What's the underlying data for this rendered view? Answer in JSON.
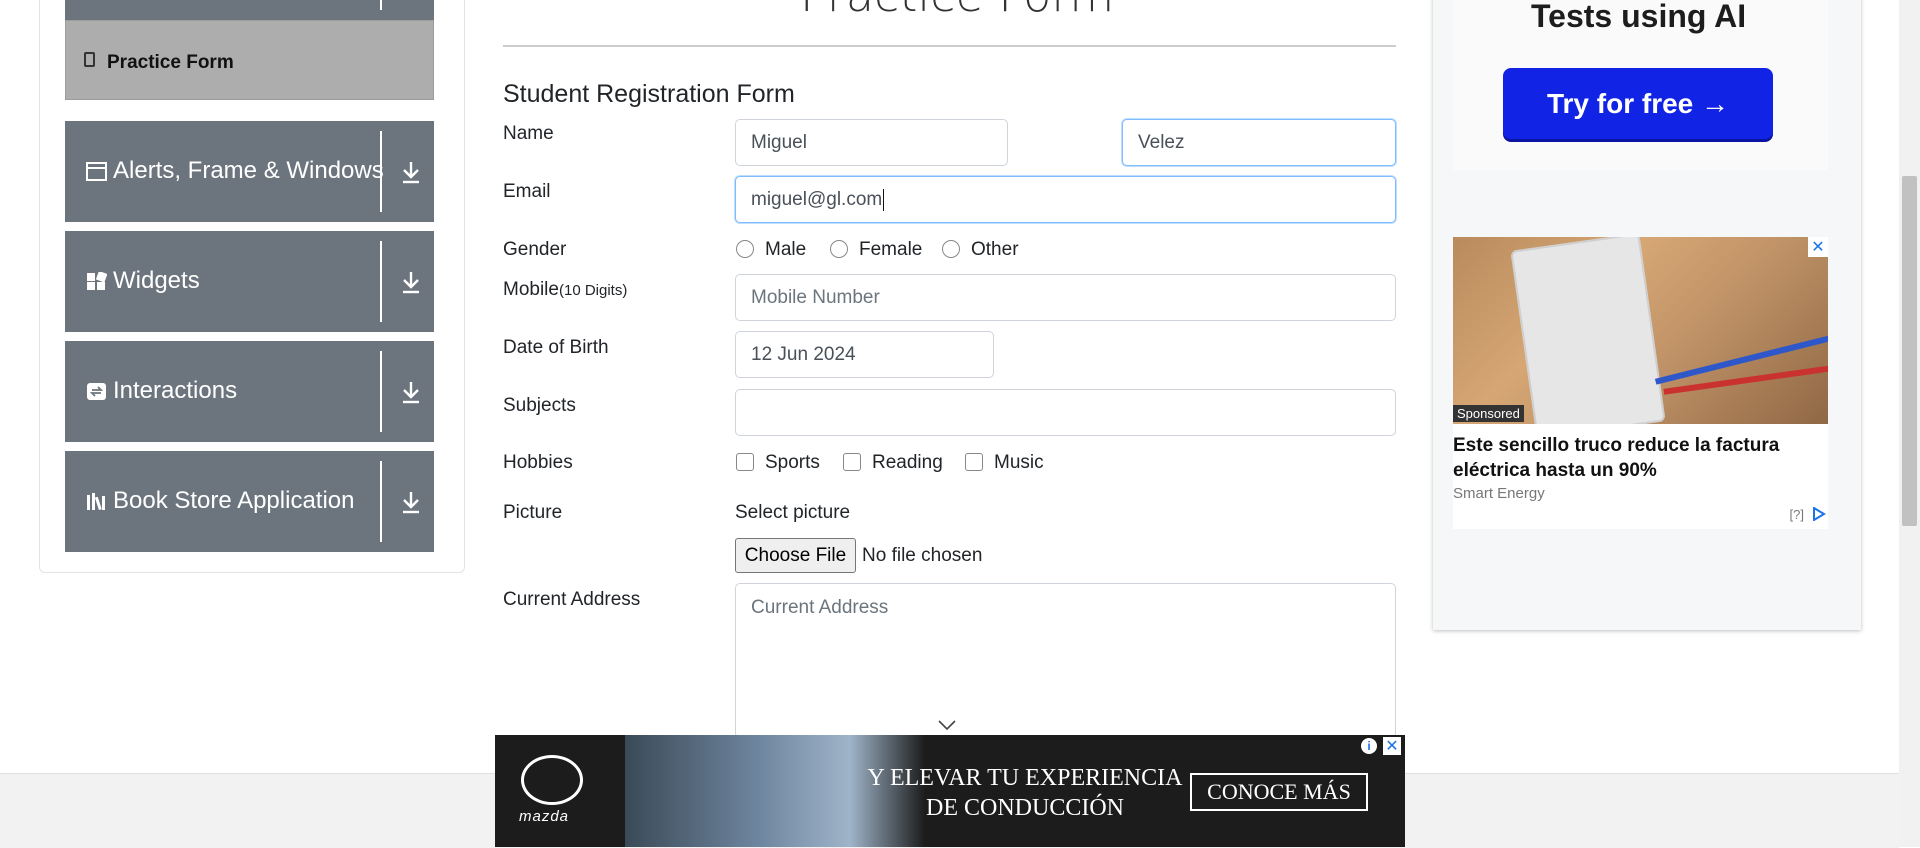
{
  "sidebar": {
    "active_item": "Practice Form",
    "groups": [
      {
        "label": "Alerts, Frame & Windows",
        "icon": "window-icon"
      },
      {
        "label": "Widgets",
        "icon": "widgets-icon"
      },
      {
        "label": "Interactions",
        "icon": "interactions-icon"
      },
      {
        "label": "Book Store Application",
        "icon": "book-store-icon"
      }
    ]
  },
  "header": {
    "title_fragment": "Practice Form"
  },
  "form": {
    "title": "Student Registration Form",
    "name_label": "Name",
    "first_name_value": "Miguel",
    "last_name_value": "Velez",
    "email_label": "Email",
    "email_value": "miguel@gl.com",
    "gender_label": "Gender",
    "gender_options": [
      "Male",
      "Female",
      "Other"
    ],
    "mobile_label": "Mobile",
    "mobile_hint": "(10 Digits)",
    "mobile_placeholder": "Mobile Number",
    "dob_label": "Date of Birth",
    "dob_value": "12 Jun 2024",
    "subjects_label": "Subjects",
    "hobbies_label": "Hobbies",
    "hobbies_options": [
      "Sports",
      "Reading",
      "Music"
    ],
    "picture_label": "Picture",
    "select_picture_text": "Select picture",
    "choose_file_label": "Choose File",
    "no_file_text": "No file chosen",
    "address_label": "Current Address",
    "address_placeholder": "Current Address"
  },
  "right_ad": {
    "heading": "Tests using AI",
    "button_label": "Try for free →",
    "sponsored_tag": "Sponsored",
    "headline": "Este sencillo truco reduce la factura eléctrica hasta un 90%",
    "brand": "Smart Energy",
    "info_label": "[?]"
  },
  "bottom_ad": {
    "logo_text": "mazda",
    "text": "Y ELEVAR TU EXPERIENCIA DE CONDUCCIÓN",
    "cta": "CONOCE MÁS"
  },
  "colors": {
    "sidebar_bg": "#6c757d",
    "active_bg": "#adadad",
    "ad_button": "#1124e6"
  }
}
